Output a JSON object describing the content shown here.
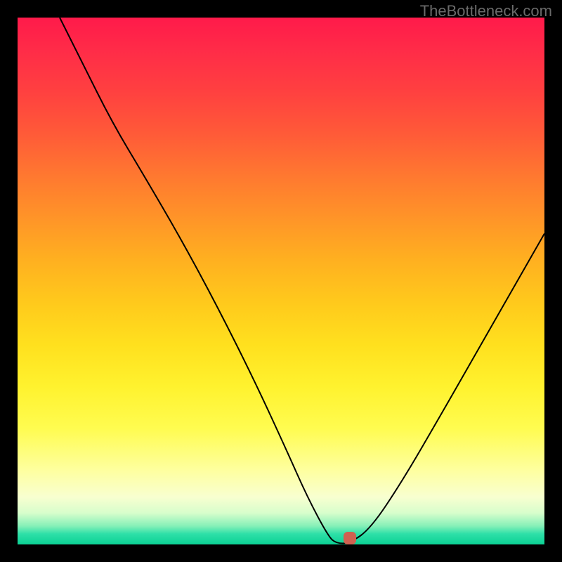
{
  "attribution": "TheBottleneck.com",
  "chart_data": {
    "type": "line",
    "title": "",
    "xlabel": "",
    "ylabel": "",
    "xlim": [
      0,
      100
    ],
    "ylim": [
      0,
      100
    ],
    "grid": false,
    "series": [
      {
        "name": "bottleneck-curve",
        "x": [
          8,
          12,
          18,
          24,
          31,
          38,
          45,
          51,
          55,
          59,
          60.5,
          63,
          67,
          73,
          80,
          88,
          96,
          100
        ],
        "y": [
          100,
          92,
          80,
          70,
          58,
          45,
          31,
          18,
          9,
          1.5,
          0.2,
          0.2,
          3,
          12,
          24,
          38,
          52,
          59
        ]
      }
    ],
    "marker": {
      "x": 63,
      "y": 1.2,
      "color": "#d06050"
    },
    "background": "rainbow-vertical-gradient"
  }
}
